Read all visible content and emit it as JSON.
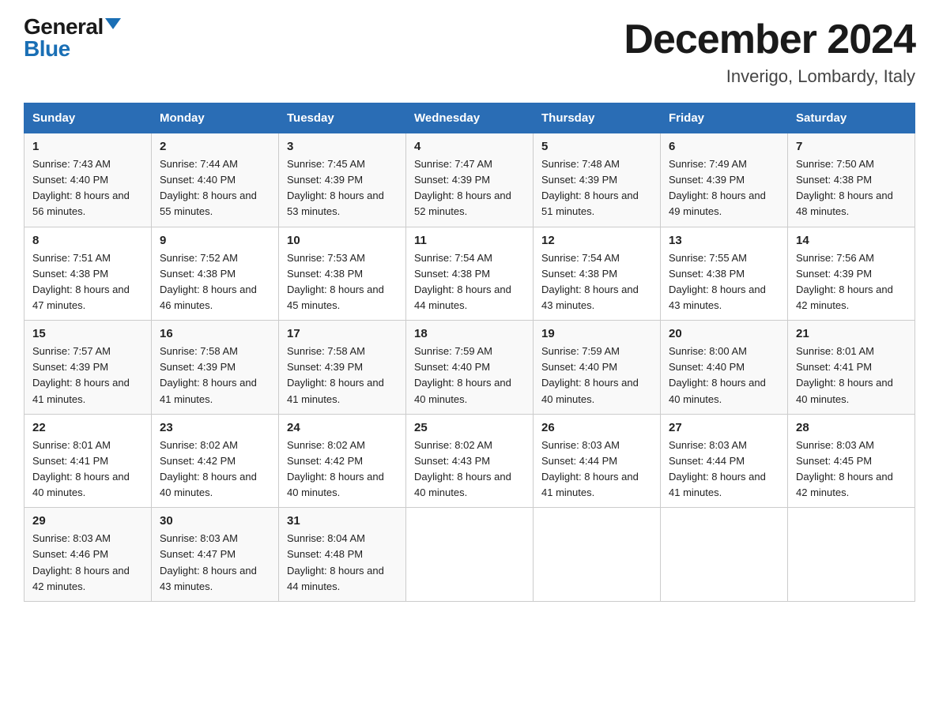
{
  "logo": {
    "general": "General",
    "blue": "Blue"
  },
  "title": {
    "month": "December 2024",
    "location": "Inverigo, Lombardy, Italy"
  },
  "headers": [
    "Sunday",
    "Monday",
    "Tuesday",
    "Wednesday",
    "Thursday",
    "Friday",
    "Saturday"
  ],
  "weeks": [
    [
      {
        "day": "1",
        "sunrise": "7:43 AM",
        "sunset": "4:40 PM",
        "daylight": "8 hours and 56 minutes."
      },
      {
        "day": "2",
        "sunrise": "7:44 AM",
        "sunset": "4:40 PM",
        "daylight": "8 hours and 55 minutes."
      },
      {
        "day": "3",
        "sunrise": "7:45 AM",
        "sunset": "4:39 PM",
        "daylight": "8 hours and 53 minutes."
      },
      {
        "day": "4",
        "sunrise": "7:47 AM",
        "sunset": "4:39 PM",
        "daylight": "8 hours and 52 minutes."
      },
      {
        "day": "5",
        "sunrise": "7:48 AM",
        "sunset": "4:39 PM",
        "daylight": "8 hours and 51 minutes."
      },
      {
        "day": "6",
        "sunrise": "7:49 AM",
        "sunset": "4:39 PM",
        "daylight": "8 hours and 49 minutes."
      },
      {
        "day": "7",
        "sunrise": "7:50 AM",
        "sunset": "4:38 PM",
        "daylight": "8 hours and 48 minutes."
      }
    ],
    [
      {
        "day": "8",
        "sunrise": "7:51 AM",
        "sunset": "4:38 PM",
        "daylight": "8 hours and 47 minutes."
      },
      {
        "day": "9",
        "sunrise": "7:52 AM",
        "sunset": "4:38 PM",
        "daylight": "8 hours and 46 minutes."
      },
      {
        "day": "10",
        "sunrise": "7:53 AM",
        "sunset": "4:38 PM",
        "daylight": "8 hours and 45 minutes."
      },
      {
        "day": "11",
        "sunrise": "7:54 AM",
        "sunset": "4:38 PM",
        "daylight": "8 hours and 44 minutes."
      },
      {
        "day": "12",
        "sunrise": "7:54 AM",
        "sunset": "4:38 PM",
        "daylight": "8 hours and 43 minutes."
      },
      {
        "day": "13",
        "sunrise": "7:55 AM",
        "sunset": "4:38 PM",
        "daylight": "8 hours and 43 minutes."
      },
      {
        "day": "14",
        "sunrise": "7:56 AM",
        "sunset": "4:39 PM",
        "daylight": "8 hours and 42 minutes."
      }
    ],
    [
      {
        "day": "15",
        "sunrise": "7:57 AM",
        "sunset": "4:39 PM",
        "daylight": "8 hours and 41 minutes."
      },
      {
        "day": "16",
        "sunrise": "7:58 AM",
        "sunset": "4:39 PM",
        "daylight": "8 hours and 41 minutes."
      },
      {
        "day": "17",
        "sunrise": "7:58 AM",
        "sunset": "4:39 PM",
        "daylight": "8 hours and 41 minutes."
      },
      {
        "day": "18",
        "sunrise": "7:59 AM",
        "sunset": "4:40 PM",
        "daylight": "8 hours and 40 minutes."
      },
      {
        "day": "19",
        "sunrise": "7:59 AM",
        "sunset": "4:40 PM",
        "daylight": "8 hours and 40 minutes."
      },
      {
        "day": "20",
        "sunrise": "8:00 AM",
        "sunset": "4:40 PM",
        "daylight": "8 hours and 40 minutes."
      },
      {
        "day": "21",
        "sunrise": "8:01 AM",
        "sunset": "4:41 PM",
        "daylight": "8 hours and 40 minutes."
      }
    ],
    [
      {
        "day": "22",
        "sunrise": "8:01 AM",
        "sunset": "4:41 PM",
        "daylight": "8 hours and 40 minutes."
      },
      {
        "day": "23",
        "sunrise": "8:02 AM",
        "sunset": "4:42 PM",
        "daylight": "8 hours and 40 minutes."
      },
      {
        "day": "24",
        "sunrise": "8:02 AM",
        "sunset": "4:42 PM",
        "daylight": "8 hours and 40 minutes."
      },
      {
        "day": "25",
        "sunrise": "8:02 AM",
        "sunset": "4:43 PM",
        "daylight": "8 hours and 40 minutes."
      },
      {
        "day": "26",
        "sunrise": "8:03 AM",
        "sunset": "4:44 PM",
        "daylight": "8 hours and 41 minutes."
      },
      {
        "day": "27",
        "sunrise": "8:03 AM",
        "sunset": "4:44 PM",
        "daylight": "8 hours and 41 minutes."
      },
      {
        "day": "28",
        "sunrise": "8:03 AM",
        "sunset": "4:45 PM",
        "daylight": "8 hours and 42 minutes."
      }
    ],
    [
      {
        "day": "29",
        "sunrise": "8:03 AM",
        "sunset": "4:46 PM",
        "daylight": "8 hours and 42 minutes."
      },
      {
        "day": "30",
        "sunrise": "8:03 AM",
        "sunset": "4:47 PM",
        "daylight": "8 hours and 43 minutes."
      },
      {
        "day": "31",
        "sunrise": "8:04 AM",
        "sunset": "4:48 PM",
        "daylight": "8 hours and 44 minutes."
      },
      null,
      null,
      null,
      null
    ]
  ]
}
